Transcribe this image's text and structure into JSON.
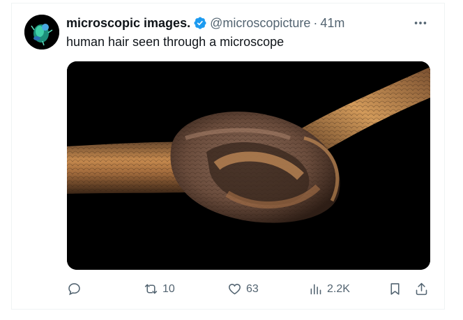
{
  "tweet": {
    "display_name": "microscopic images.",
    "handle": "@microscopicture",
    "separator": "·",
    "timestamp": "41m",
    "text": "human hair seen through a microscope",
    "verified": true,
    "avatar_icon": "microscopic-creature-avatar",
    "media_description_icon": "hair-knot-image"
  },
  "actions": {
    "reply_count": "",
    "retweet_count": "10",
    "like_count": "63",
    "views_count": "2.2K"
  },
  "colors": {
    "text_primary": "#0f1419",
    "text_secondary": "#536471",
    "verified_blue": "#1d9bf0"
  }
}
